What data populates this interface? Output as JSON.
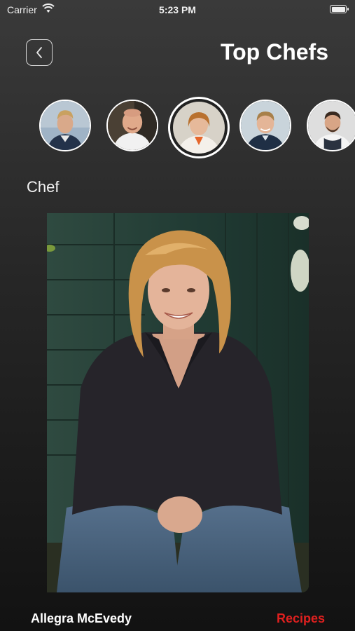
{
  "status": {
    "carrier": "Carrier",
    "time": "5:23 PM"
  },
  "header": {
    "title": "Top Chefs",
    "back_icon": "chevron-left-icon"
  },
  "chefs_strip": {
    "count": 5,
    "selected_index": 2
  },
  "section": {
    "label": "Chef"
  },
  "footer": {
    "chef_name": "Allegra McEvedy",
    "recipes_label": "Recipes"
  },
  "colors": {
    "accent": "#e0201f",
    "background_top": "#3a3a3a",
    "background_bottom": "#121212",
    "text": "#ffffff"
  }
}
